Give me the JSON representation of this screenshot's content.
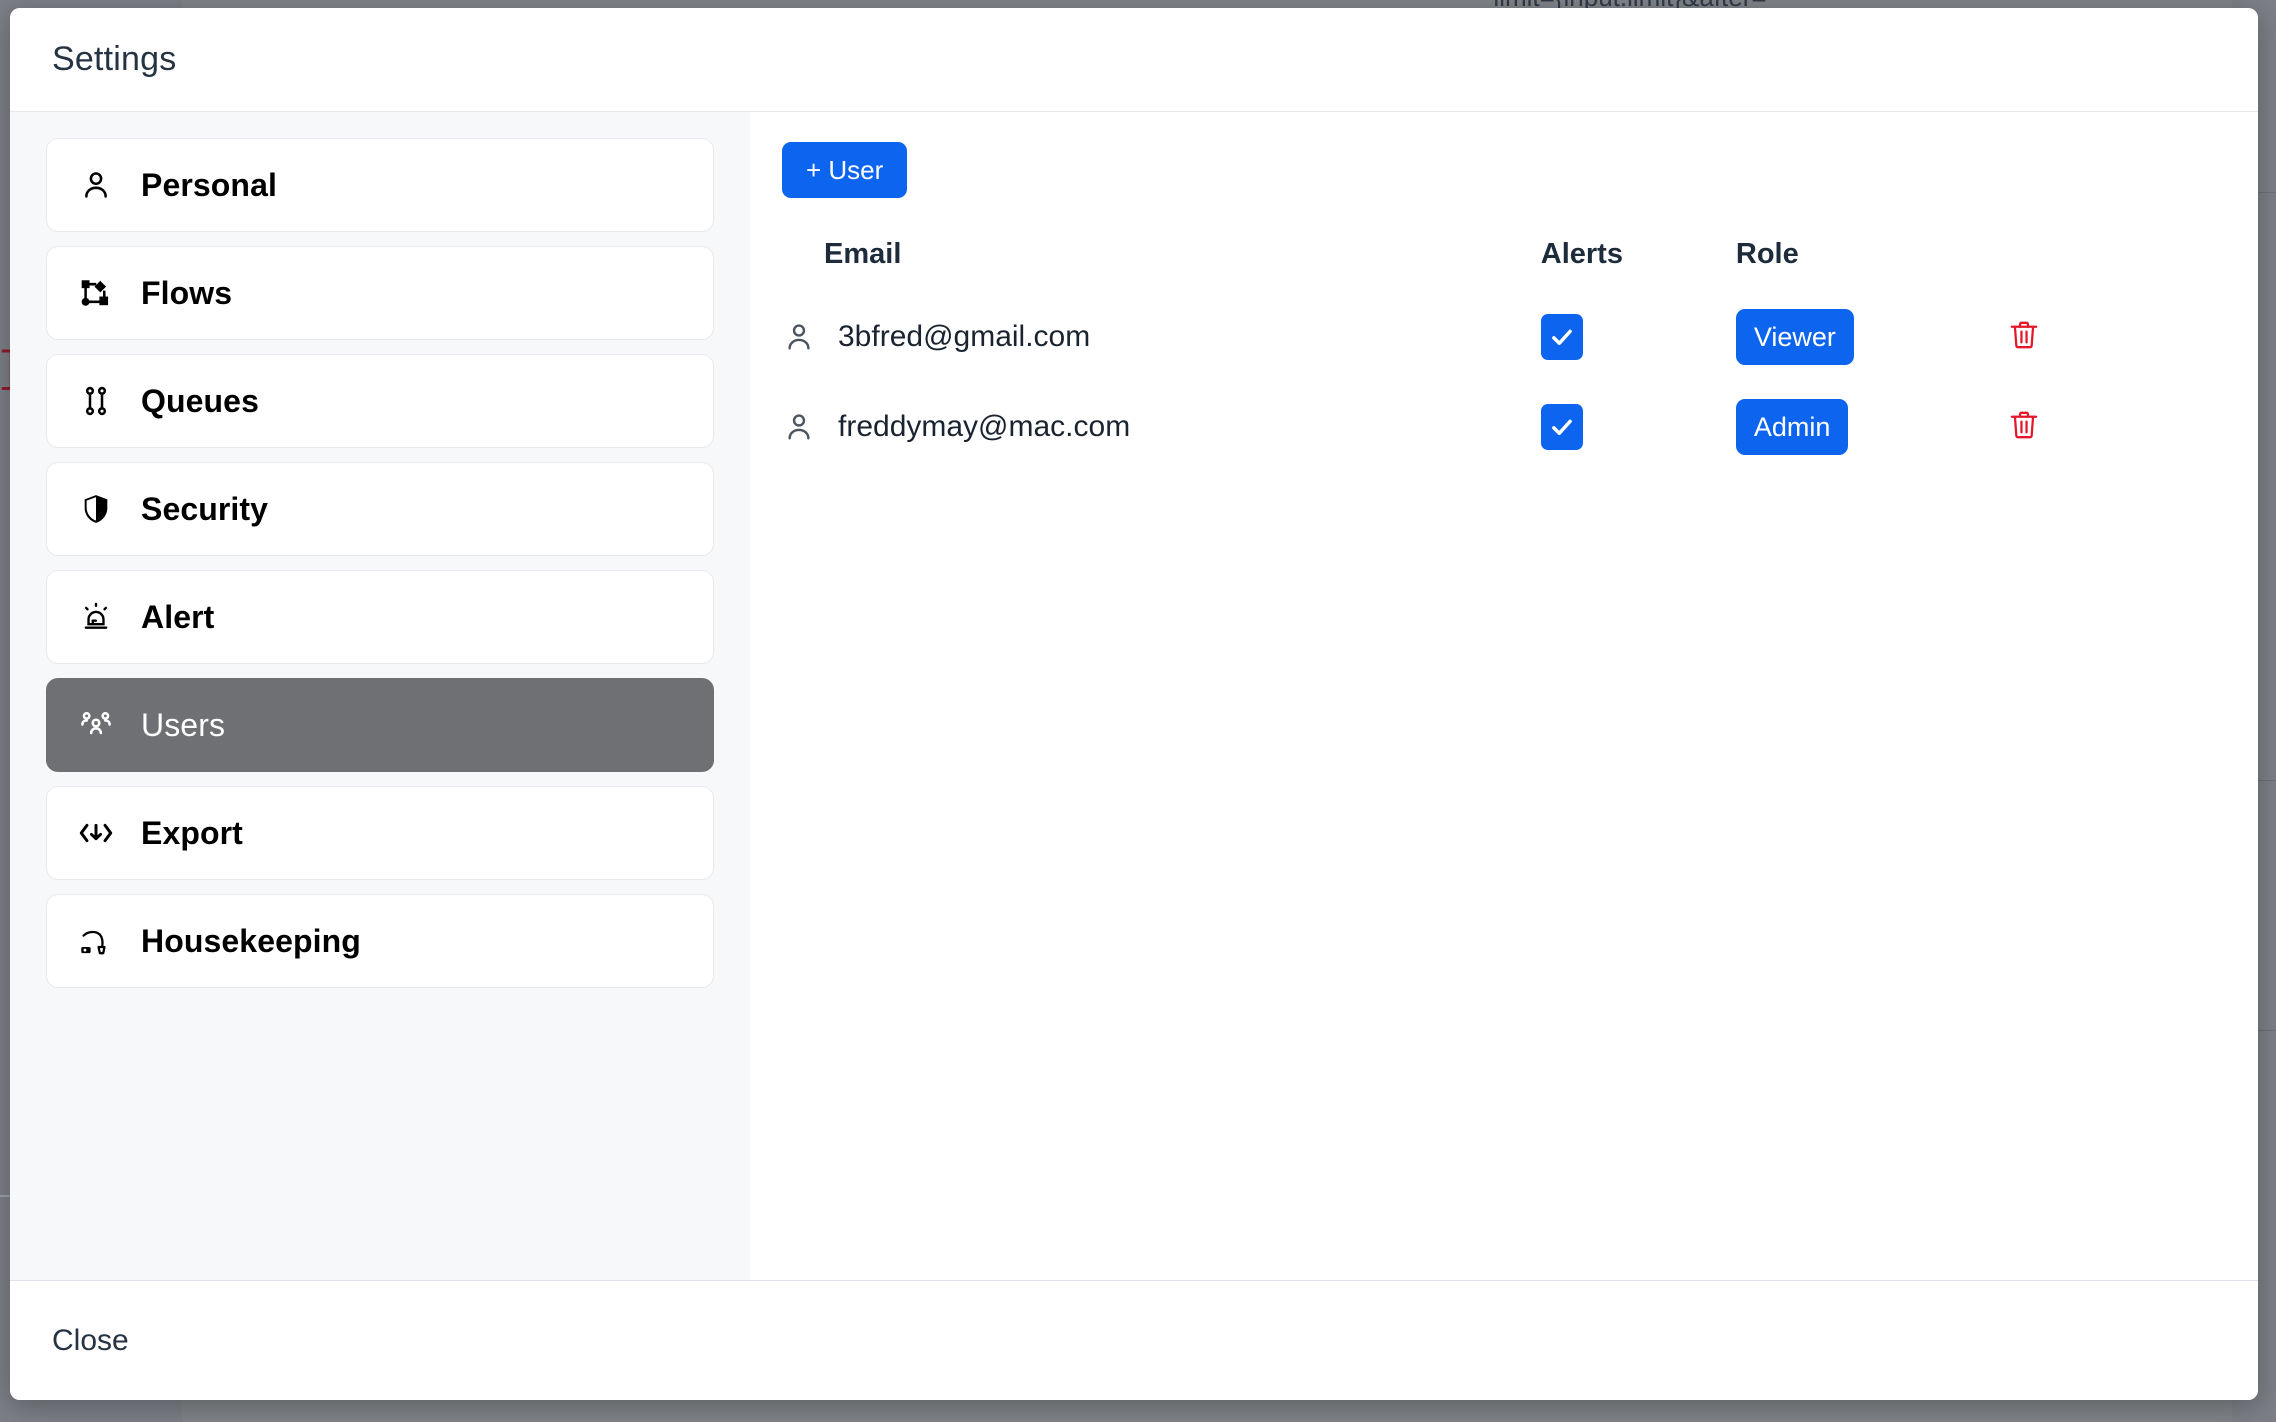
{
  "background": {
    "code_snippet": "limit={input.limit}&after=",
    "bracket_glyph": "]"
  },
  "modal": {
    "title": "Settings",
    "footer": {
      "close_label": "Close"
    }
  },
  "sidebar": {
    "items": [
      {
        "label": "Personal",
        "icon": "person-icon",
        "active": false
      },
      {
        "label": "Flows",
        "icon": "flow-icon",
        "active": false
      },
      {
        "label": "Queues",
        "icon": "queues-icon",
        "active": false
      },
      {
        "label": "Security",
        "icon": "shield-icon",
        "active": false
      },
      {
        "label": "Alert",
        "icon": "siren-icon",
        "active": false
      },
      {
        "label": "Users",
        "icon": "users-icon",
        "active": true
      },
      {
        "label": "Export",
        "icon": "export-icon",
        "active": false
      },
      {
        "label": "Housekeeping",
        "icon": "vacuum-icon",
        "active": false
      }
    ]
  },
  "content": {
    "add_user_label": "+ User",
    "table": {
      "headers": {
        "email": "Email",
        "alerts": "Alerts",
        "role": "Role",
        "actions": ""
      },
      "rows": [
        {
          "email": "3bfred@gmail.com",
          "alerts_checked": true,
          "role": "Viewer",
          "delete_icon": "trash-icon"
        },
        {
          "email": "freddymay@mac.com",
          "alerts_checked": true,
          "role": "Admin",
          "delete_icon": "trash-icon"
        }
      ]
    }
  },
  "colors": {
    "accent_blue": "#0d64ef",
    "danger_red": "#e3192b",
    "active_sidebar": "#6e7073",
    "title_text": "#253343"
  }
}
